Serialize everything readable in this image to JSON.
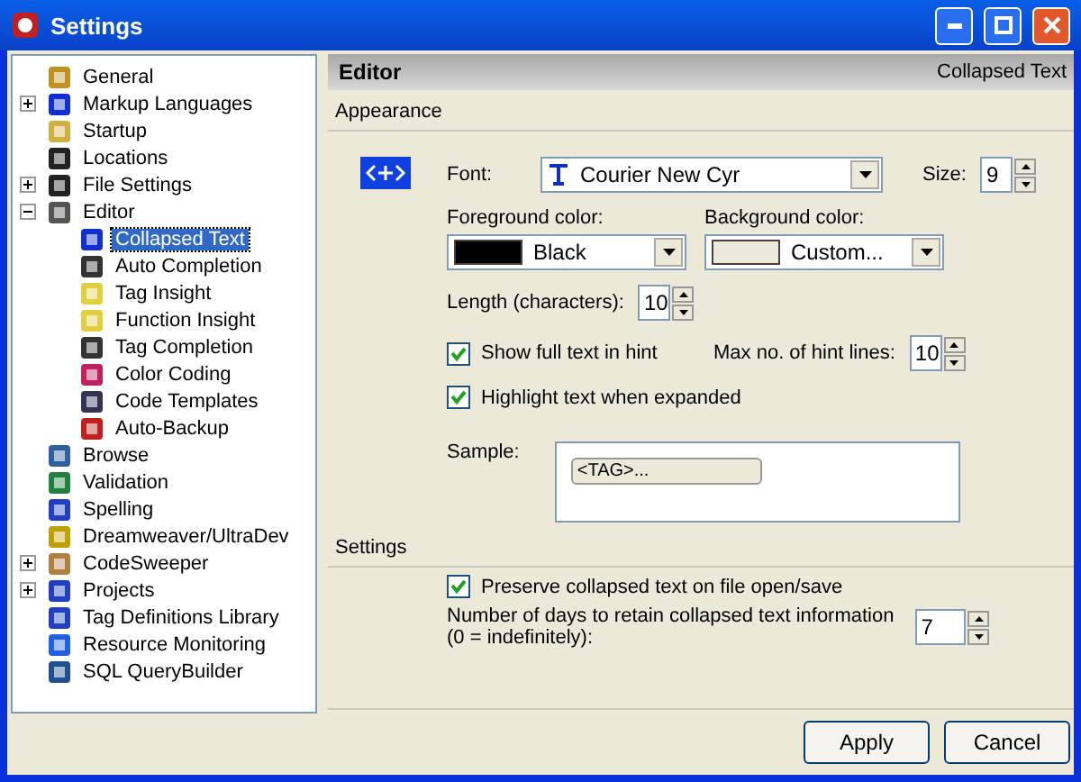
{
  "window": {
    "title": "Settings"
  },
  "tree": [
    {
      "label": "General",
      "selected": false
    },
    {
      "label": "Markup Languages",
      "selected": false,
      "expanded": false
    },
    {
      "label": "Startup",
      "selected": false
    },
    {
      "label": "Locations",
      "selected": false
    },
    {
      "label": "File Settings",
      "selected": false,
      "expanded": false
    },
    {
      "label": "Editor",
      "selected": false,
      "expanded": true,
      "children": [
        {
          "label": "Collapsed Text",
          "selected": true
        },
        {
          "label": "Auto Completion",
          "selected": false
        },
        {
          "label": "Tag Insight",
          "selected": false
        },
        {
          "label": "Function Insight",
          "selected": false
        },
        {
          "label": "Tag Completion",
          "selected": false
        },
        {
          "label": "Color Coding",
          "selected": false
        },
        {
          "label": "Code Templates",
          "selected": false
        },
        {
          "label": "Auto-Backup",
          "selected": false
        }
      ]
    },
    {
      "label": "Browse",
      "selected": false
    },
    {
      "label": "Validation",
      "selected": false
    },
    {
      "label": "Spelling",
      "selected": false
    },
    {
      "label": "Dreamweaver/UltraDev",
      "selected": false
    },
    {
      "label": "CodeSweeper",
      "selected": false,
      "expanded": false
    },
    {
      "label": "Projects",
      "selected": false,
      "expanded": false
    },
    {
      "label": "Tag Definitions Library",
      "selected": false
    },
    {
      "label": "Resource Monitoring",
      "selected": false
    },
    {
      "label": "SQL QueryBuilder",
      "selected": false
    }
  ],
  "header": {
    "title": "Editor",
    "page": "Collapsed Text"
  },
  "appearance": {
    "title": "Appearance",
    "font": {
      "label": "Font:",
      "value": "Courier New Cyr"
    },
    "size": {
      "label": "Size:",
      "value": "9"
    },
    "foreground": {
      "label": "Foreground color:",
      "value": "Black",
      "color": "#000000"
    },
    "background": {
      "label": "Background color:",
      "value": "Custom...",
      "color": "#ece9d8"
    },
    "length": {
      "label": "Length (characters):",
      "value": "10"
    },
    "show_hint": {
      "label": "Show full text in hint",
      "checked": true
    },
    "max_lines": {
      "label": "Max no. of hint lines:",
      "value": "10"
    },
    "highlight": {
      "label": "Highlight text when expanded",
      "checked": true
    },
    "sample": {
      "label": "Sample:",
      "text": "<TAG>..."
    }
  },
  "settings": {
    "title": "Settings",
    "preserve": {
      "label": "Preserve collapsed text on file open/save",
      "checked": true
    },
    "days": {
      "label": "Number of days to retain collapsed text information",
      "note": "(0 = indefinitely):",
      "value": "7"
    }
  },
  "buttons": [
    "Apply",
    "Cancel"
  ]
}
